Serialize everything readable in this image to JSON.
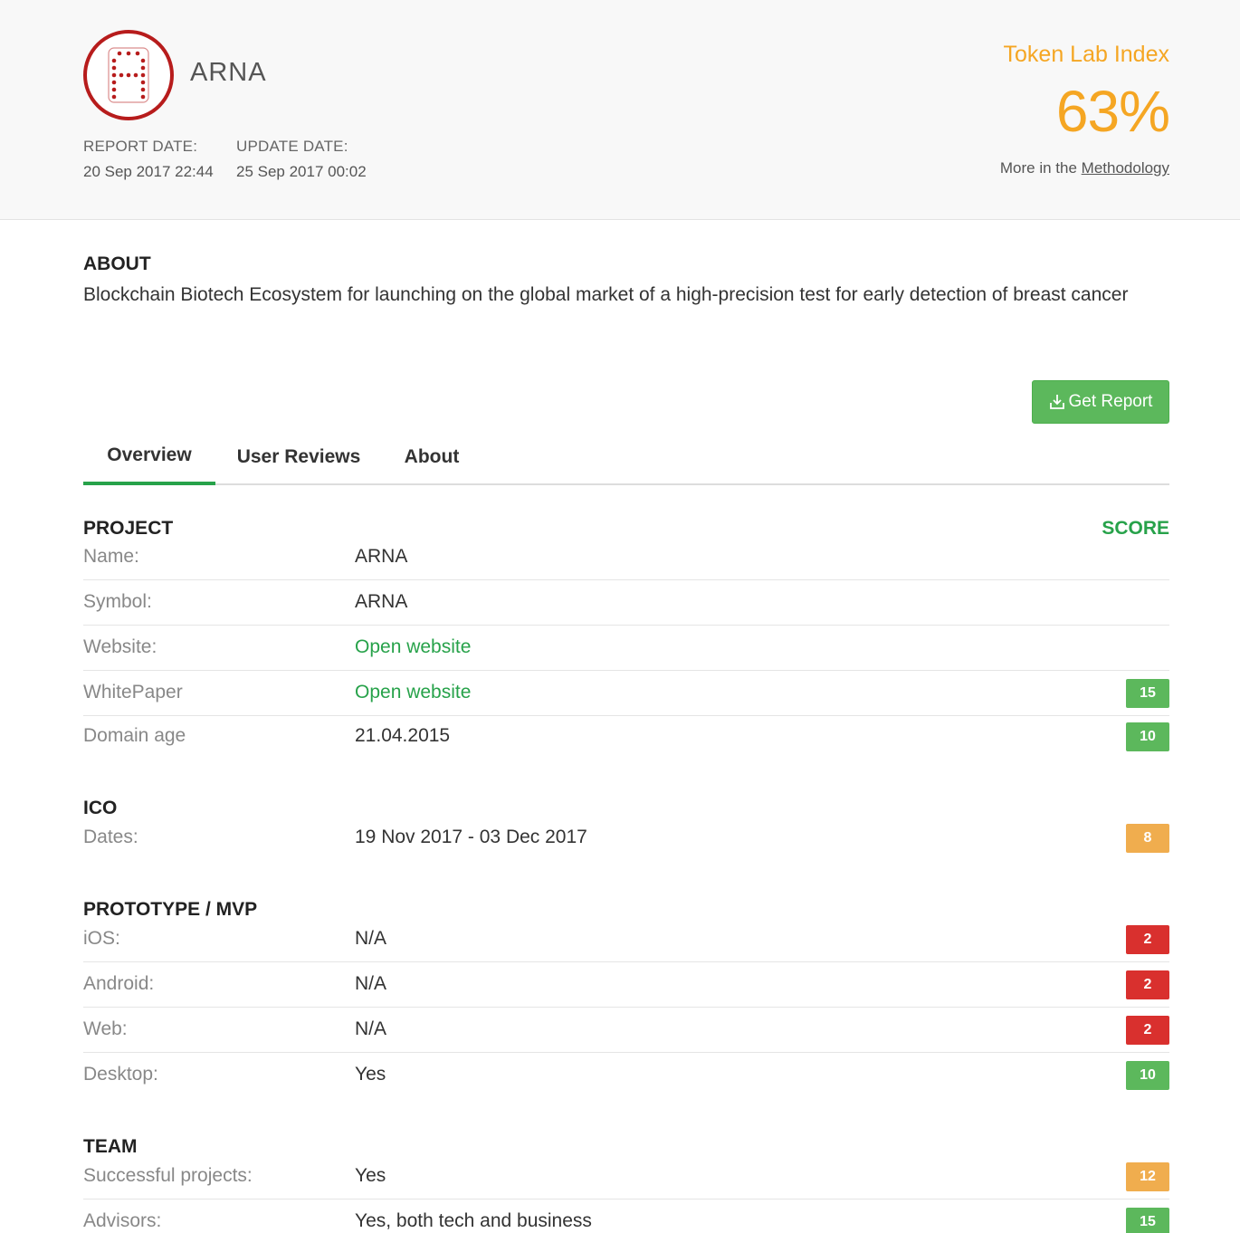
{
  "header": {
    "project_name": "ARNA",
    "report_date_label": "REPORT DATE:",
    "report_date": "20 Sep 2017 22:44",
    "update_date_label": "UPDATE DATE:",
    "update_date": "25 Sep 2017 00:02",
    "index_label": "Token Lab Index",
    "index_value": "63%",
    "more_text": "More in the",
    "methodology_link": "Methodology"
  },
  "about": {
    "title": "ABOUT",
    "text": "Blockchain Biotech Ecosystem for launching on the global market of a high-precision test for early detection of breast cancer"
  },
  "get_report_label": "Get Report",
  "tabs": [
    {
      "label": "Overview",
      "active": true
    },
    {
      "label": "User Reviews",
      "active": false
    },
    {
      "label": "About",
      "active": false
    }
  ],
  "score_label": "SCORE",
  "sections": {
    "project": {
      "title": "PROJECT",
      "rows": [
        {
          "label": "Name:",
          "value": "ARNA"
        },
        {
          "label": "Symbol:",
          "value": "ARNA"
        },
        {
          "label": "Website:",
          "value": "Open website"
        },
        {
          "label": "WhitePaper",
          "value": "Open website",
          "score": "15"
        },
        {
          "label": "Domain age",
          "value": "21.04.2015",
          "score": "10"
        }
      ]
    },
    "ico": {
      "title": "ICO",
      "rows": [
        {
          "label": "Dates:",
          "value": "19 Nov 2017 - 03 Dec 2017",
          "score": "8"
        }
      ]
    },
    "prototype": {
      "title": "PROTOTYPE / MVP",
      "rows": [
        {
          "label": "iOS:",
          "value": "N/A",
          "score": "2"
        },
        {
          "label": "Android:",
          "value": "N/A",
          "score": "2"
        },
        {
          "label": "Web:",
          "value": "N/A",
          "score": "2"
        },
        {
          "label": "Desktop:",
          "value": "Yes",
          "score": "10"
        }
      ]
    },
    "team": {
      "title": "TEAM",
      "rows": [
        {
          "label": "Successful projects:",
          "value": "Yes",
          "score": "12"
        },
        {
          "label": "Advisors:",
          "value": "Yes, both tech and business",
          "score": "15"
        }
      ]
    }
  },
  "colors": {
    "accent_green": "#27a24a",
    "index_orange": "#f5a623",
    "badge_green": "#5cb85c",
    "badge_orange": "#f0ad4e",
    "badge_red": "#d9302e",
    "logo_red": "#b71c1c"
  },
  "icons": {
    "logo": "arna-logo",
    "download": "download-icon"
  }
}
